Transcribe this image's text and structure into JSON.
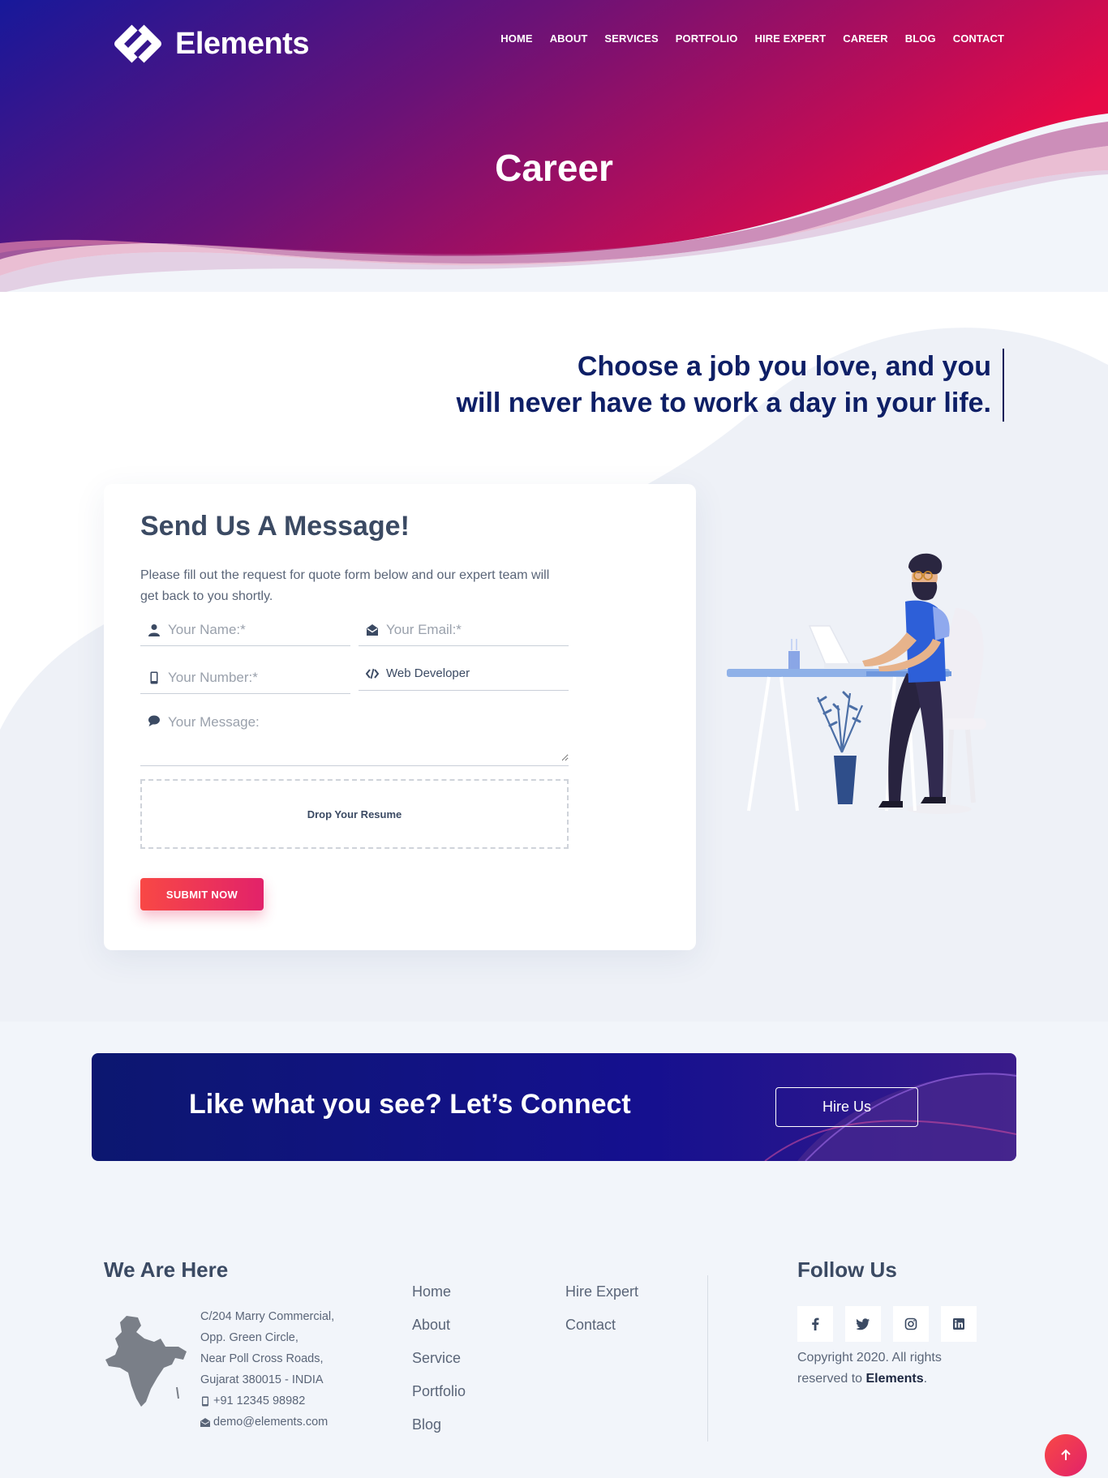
{
  "brand": {
    "name": "Elements"
  },
  "nav": {
    "items": [
      {
        "label": "HOME"
      },
      {
        "label": "ABOUT"
      },
      {
        "label": "SERVICES"
      },
      {
        "label": "PORTFOLIO"
      },
      {
        "label": "HIRE EXPERT"
      },
      {
        "label": "CAREER"
      },
      {
        "label": "BLOG"
      },
      {
        "label": "CONTACT"
      }
    ]
  },
  "hero": {
    "title": "Career"
  },
  "quote": {
    "line1": "Choose a job you love, and you",
    "line2": "will never have to work a day in your life."
  },
  "form": {
    "heading": "Send Us A Message!",
    "intro": "Please fill out the request for quote form below and our expert team will get back to you shortly.",
    "name_placeholder": "Your Name:*",
    "email_placeholder": "Your Email:*",
    "number_placeholder": "Your Number:*",
    "position_value": "Web Developer",
    "message_placeholder": "Your Message:",
    "dropzone_label": "Drop Your Resume",
    "submit_label": "SUBMIT NOW"
  },
  "cta": {
    "title": "Like what you see? Let’s Connect",
    "button": "Hire Us"
  },
  "footer": {
    "location_heading": "We Are Here",
    "address_lines": [
      "C/204 Marry Commercial,",
      "Opp. Green Circle,",
      "Near Poll Cross Roads,",
      "Gujarat 380015 - INDIA"
    ],
    "phone": "+91 12345 98982",
    "email": "demo@elements.com",
    "links_col1": [
      "Home",
      "About",
      "Service",
      "Portfolio",
      "Blog"
    ],
    "links_col2": [
      "Hire Expert",
      "Contact"
    ],
    "follow_heading": "Follow Us",
    "social": [
      "facebook-icon",
      "twitter-icon",
      "instagram-icon",
      "linkedin-icon"
    ],
    "copyright_prefix": "Copyright 2020. All rights reserved to ",
    "copyright_brand": "Elements",
    "copyright_suffix": "."
  },
  "colors": {
    "hero_start": "#1a1a8c",
    "hero_end": "#e0104a",
    "navy": "#0e1f66",
    "accent": "#f84845"
  }
}
